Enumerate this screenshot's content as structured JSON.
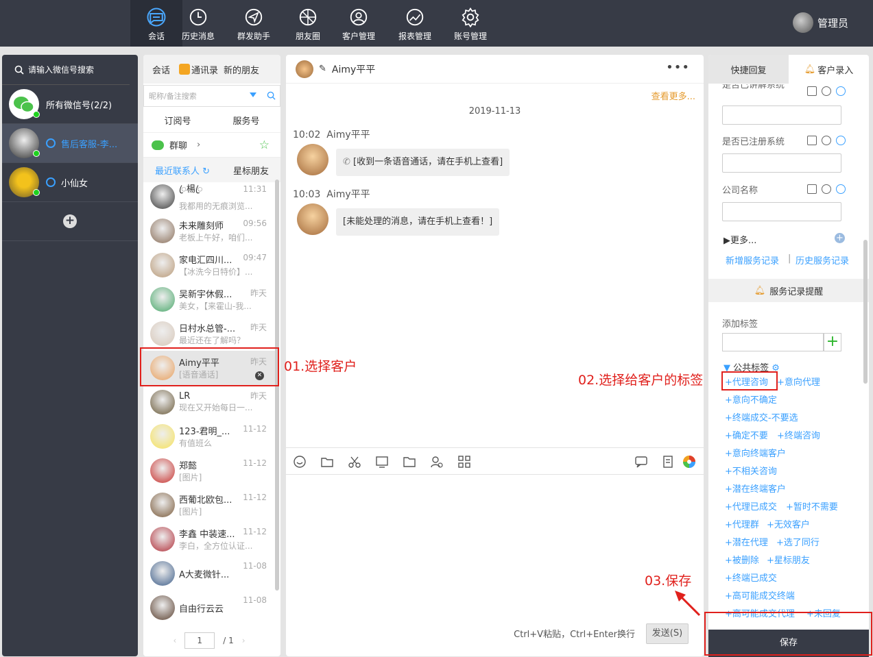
{
  "nav": [
    {
      "label": "会话",
      "icon": "chat-icon",
      "active": true
    },
    {
      "label": "历史消息",
      "icon": "clock-icon"
    },
    {
      "label": "群发助手",
      "icon": "send-icon"
    },
    {
      "label": "朋友圈",
      "icon": "aperture-icon"
    },
    {
      "label": "客户管理",
      "icon": "user-icon"
    },
    {
      "label": "报表管理",
      "icon": "chart-icon"
    },
    {
      "label": "账号管理",
      "icon": "gear-icon"
    }
  ],
  "admin": "管理员",
  "accounts": {
    "search": "请输入微信号搜索",
    "all": "所有微信号(2/2)",
    "items": [
      "售后客服-李...",
      "小仙女"
    ]
  },
  "contacts": {
    "tabs": [
      "会话",
      "通讯录",
      "新的朋友"
    ],
    "search_placeholder": "昵称/备注搜索",
    "sub": [
      "订阅号",
      "服务号"
    ],
    "group": "群聊",
    "recent": [
      "最近联系人",
      "星标朋友"
    ],
    "items": [
      {
        "name": "ꦿ楊ꦿ",
        "msg": "我都用的无痕浏览...",
        "time": "11:31",
        "color": "#3c3c3c"
      },
      {
        "name": "未来雕刻师",
        "msg": "老板上午好，咱们...",
        "time": "09:56",
        "color": "#8a6f5a"
      },
      {
        "name": "家电汇四川...",
        "msg": "【冰洗今日特价】...",
        "time": "09:47",
        "color": "#b99a78"
      },
      {
        "name": "吴新宇休假...",
        "msg": "美女，【来霍山-我...",
        "time": "昨天",
        "color": "#4aa86b"
      },
      {
        "name": "日村水总管-...",
        "msg": "最近还在了解吗？",
        "time": "昨天",
        "color": "#d7c7b8"
      },
      {
        "name": "Aimy平平",
        "msg": "[语音通话]",
        "time": "昨天",
        "color": "#e8a05e"
      },
      {
        "name": "LR",
        "msg": "现在又开始每日一...",
        "time": "昨天",
        "color": "#6a5a3a"
      },
      {
        "name": "123-君明_...",
        "msg": "有值班么",
        "time": "11-12",
        "color": "#f6e25a"
      },
      {
        "name": "郑懿",
        "msg": "[图片]",
        "time": "11-12",
        "color": "#c8322f"
      },
      {
        "name": "西葡北欧包...",
        "msg": "[图片]",
        "time": "11-12",
        "color": "#7a5a3a"
      },
      {
        "name": "李鑫 中装速...",
        "msg": "李白，全方位认证...",
        "time": "11-12",
        "color": "#b0303a"
      },
      {
        "name": "A大麦微针...",
        "msg": "",
        "time": "11-08",
        "color": "#3f5f8a"
      },
      {
        "name": "自由行云云",
        "msg": "",
        "time": "11-08",
        "color": "#5a4030"
      }
    ],
    "page": "1",
    "total": "/ 1"
  },
  "chat": {
    "name": "Aimy平平",
    "more": "查看更多...",
    "date": "2019-11-13",
    "messages": [
      {
        "time": "10:02",
        "sender": "Aimy平平",
        "text": "[收到一条语音通话，请在手机上查看]"
      },
      {
        "time": "10:03",
        "sender": "Aimy平平",
        "text": "[未能处理的消息，请在手机上查看！]"
      }
    ],
    "hint": "Ctrl+V粘贴，Ctrl+Enter换行",
    "send": "发送(S)"
  },
  "panel": {
    "tabs": [
      "快捷回复",
      "客户录入"
    ],
    "fields": [
      "是否已讲解系统",
      "是否已注册系统",
      "公司名称"
    ],
    "more": "更多...",
    "new_record": "新增服务记录",
    "sep": "|",
    "history": "历史服务记录",
    "reminder": "服务记录提醒",
    "add_tag": "添加标签",
    "public_tags": "公共标签",
    "tags": [
      "+代理咨询",
      "+意向代理",
      "+意向不确定",
      "+终端成交-不要选",
      "+确定不要",
      "+终端咨询",
      "+意向终端客户",
      "+不相关咨询",
      "+潜在终端客户",
      "+代理已成交",
      "+暂时不需要",
      "+代理群",
      "+无效客户",
      "+潜在代理",
      "+选了同行",
      "+被删除",
      "+星标朋友",
      "+终端已成交",
      "+高可能成交终端",
      "+高可能成交代理",
      "+未回复"
    ],
    "save": "保存"
  },
  "annotations": [
    "01.选择客户",
    "02.选择给客户的标签",
    "03.保存"
  ],
  "colors": {
    "accent": "#3aa0ff",
    "dark": "#373b46",
    "annotation": "#e0201c",
    "link_orange": "#e59a2c"
  }
}
